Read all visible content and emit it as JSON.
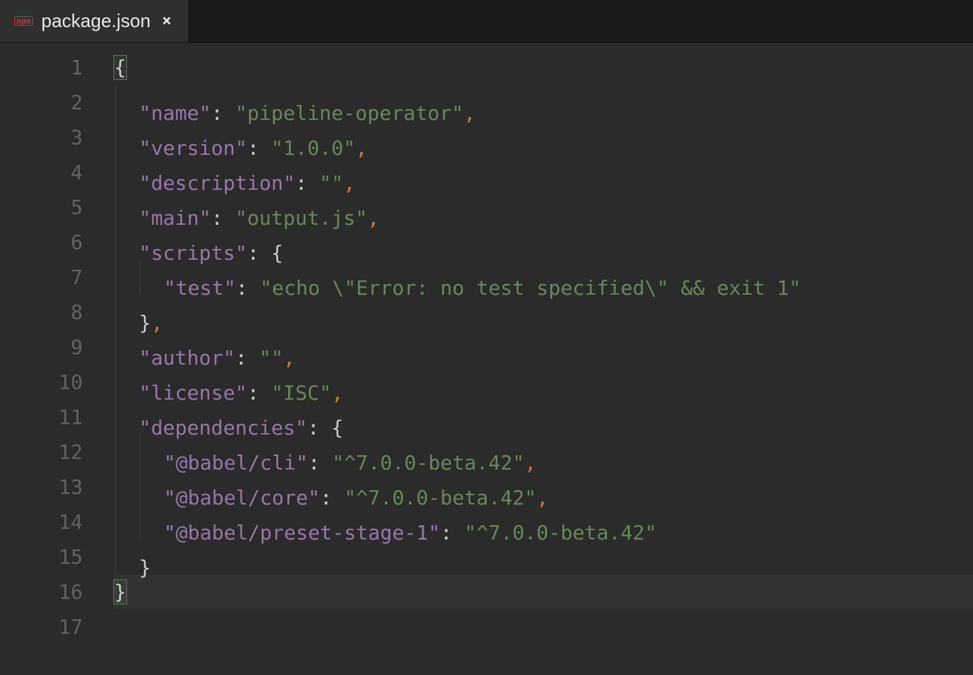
{
  "tab": {
    "icon_name": "npm-icon",
    "title": "package.json"
  },
  "gutter": {
    "lines": [
      "1",
      "2",
      "3",
      "4",
      "5",
      "6",
      "7",
      "8",
      "9",
      "10",
      "11",
      "12",
      "13",
      "14",
      "15",
      "16",
      "17"
    ]
  },
  "code": {
    "current_line": 16,
    "lines": [
      [
        {
          "t": "brace",
          "v": "{",
          "hl": true
        }
      ],
      [
        {
          "t": "indent",
          "n": 1
        },
        {
          "t": "key",
          "v": "\"name\""
        },
        {
          "t": "colon",
          "v": ": "
        },
        {
          "t": "str",
          "v": "\"pipeline-operator\""
        },
        {
          "t": "comma",
          "v": ","
        }
      ],
      [
        {
          "t": "indent",
          "n": 1
        },
        {
          "t": "key",
          "v": "\"version\""
        },
        {
          "t": "colon",
          "v": ": "
        },
        {
          "t": "str",
          "v": "\"1.0.0\""
        },
        {
          "t": "comma",
          "v": ","
        }
      ],
      [
        {
          "t": "indent",
          "n": 1
        },
        {
          "t": "key",
          "v": "\"description\""
        },
        {
          "t": "colon",
          "v": ": "
        },
        {
          "t": "str",
          "v": "\"\""
        },
        {
          "t": "comma",
          "v": ","
        }
      ],
      [
        {
          "t": "indent",
          "n": 1
        },
        {
          "t": "key",
          "v": "\"main\""
        },
        {
          "t": "colon",
          "v": ": "
        },
        {
          "t": "str",
          "v": "\"output.js\""
        },
        {
          "t": "comma",
          "v": ","
        }
      ],
      [
        {
          "t": "indent",
          "n": 1
        },
        {
          "t": "key",
          "v": "\"scripts\""
        },
        {
          "t": "colon",
          "v": ": "
        },
        {
          "t": "punc",
          "v": "{"
        }
      ],
      [
        {
          "t": "indent",
          "n": 2
        },
        {
          "t": "key",
          "v": "\"test\""
        },
        {
          "t": "colon",
          "v": ": "
        },
        {
          "t": "str",
          "v": "\"echo \\\"Error: no test specified\\\" && exit 1\""
        }
      ],
      [
        {
          "t": "indent",
          "n": 1
        },
        {
          "t": "punc",
          "v": "}"
        },
        {
          "t": "comma",
          "v": ","
        }
      ],
      [
        {
          "t": "indent",
          "n": 1
        },
        {
          "t": "key",
          "v": "\"author\""
        },
        {
          "t": "colon",
          "v": ": "
        },
        {
          "t": "str",
          "v": "\"\""
        },
        {
          "t": "comma",
          "v": ","
        }
      ],
      [
        {
          "t": "indent",
          "n": 1
        },
        {
          "t": "key",
          "v": "\"license\""
        },
        {
          "t": "colon",
          "v": ": "
        },
        {
          "t": "str",
          "v": "\"ISC\""
        },
        {
          "t": "comma",
          "v": ","
        }
      ],
      [
        {
          "t": "indent",
          "n": 1
        },
        {
          "t": "key",
          "v": "\"dependencies\""
        },
        {
          "t": "colon",
          "v": ": "
        },
        {
          "t": "punc",
          "v": "{"
        }
      ],
      [
        {
          "t": "indent",
          "n": 2
        },
        {
          "t": "key",
          "v": "\"@babel/cli\""
        },
        {
          "t": "colon",
          "v": ": "
        },
        {
          "t": "str",
          "v": "\"^7.0.0-beta.42\""
        },
        {
          "t": "comma",
          "v": ","
        }
      ],
      [
        {
          "t": "indent",
          "n": 2
        },
        {
          "t": "key",
          "v": "\"@babel/core\""
        },
        {
          "t": "colon",
          "v": ": "
        },
        {
          "t": "str",
          "v": "\"^7.0.0-beta.42\""
        },
        {
          "t": "comma",
          "v": ","
        }
      ],
      [
        {
          "t": "indent",
          "n": 2
        },
        {
          "t": "key",
          "v": "\"@babel/preset-stage-1\""
        },
        {
          "t": "colon",
          "v": ": "
        },
        {
          "t": "str",
          "v": "\"^7.0.0-beta.42\""
        }
      ],
      [
        {
          "t": "indent",
          "n": 1
        },
        {
          "t": "punc",
          "v": "}"
        }
      ],
      [
        {
          "t": "brace",
          "v": "}",
          "hl": true
        }
      ],
      []
    ]
  }
}
